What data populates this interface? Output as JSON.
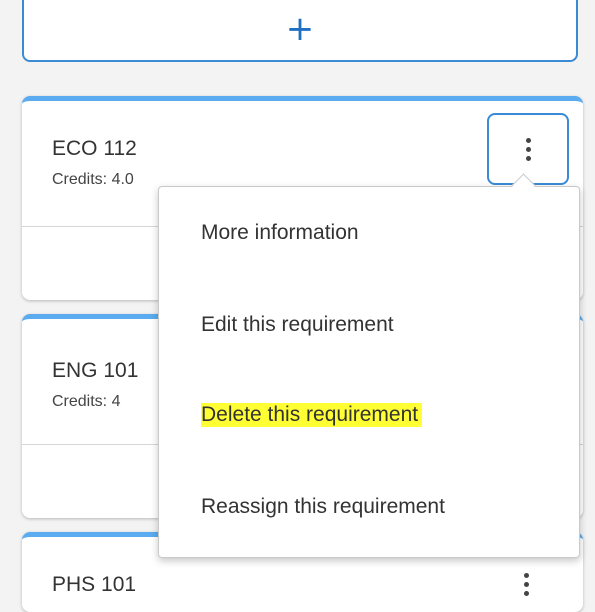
{
  "add_button": {
    "label": "+"
  },
  "cards": [
    {
      "course": "ECO 112",
      "credits": "Credits: 4.0"
    },
    {
      "course": "ENG 101",
      "credits": "Credits: 4"
    },
    {
      "course": "PHS 101"
    }
  ],
  "menu": {
    "items": [
      {
        "label": "More information"
      },
      {
        "label": "Edit this requirement"
      },
      {
        "label": "Delete this requirement",
        "highlighted": true
      },
      {
        "label": "Reassign this requirement"
      }
    ]
  },
  "colors": {
    "accent_border": "#3a8ad6",
    "card_top": "#5aabf0",
    "highlight": "#ffff33"
  }
}
